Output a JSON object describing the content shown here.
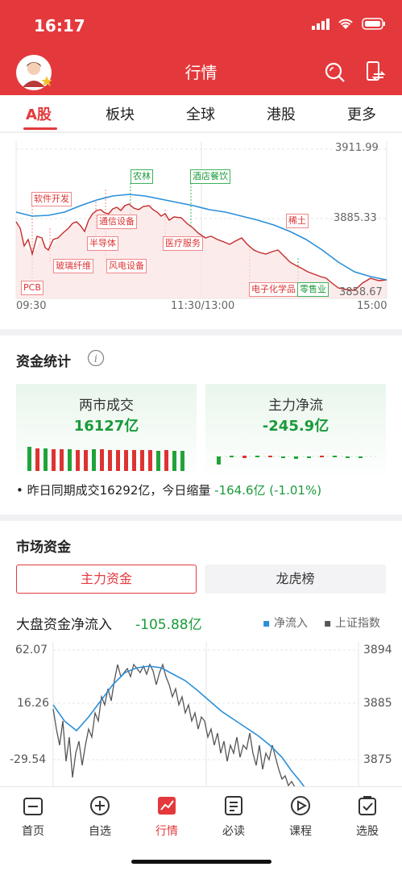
{
  "status": {
    "time": "16:17"
  },
  "header": {
    "title": "行情"
  },
  "tabs": [
    "A股",
    "板块",
    "全球",
    "港股",
    "更多"
  ],
  "colors": {
    "brand_red": "#e4393c",
    "up_red": "#d33",
    "down_green": "#1a9a3a",
    "line_blue": "#2a8fd8"
  },
  "index_chart": {
    "y_top": "3911.99",
    "y_mid": "3885.33",
    "y_bottom": "3858.67",
    "x_start": "09:30",
    "x_mid": "11:30/13:00",
    "x_end": "15:00",
    "tags_red": [
      "软件开发",
      "通信设备",
      "半导体",
      "玻璃纤维",
      "风电设备",
      "医疗服务",
      "稀土",
      "电子化学品",
      "PCB"
    ],
    "tags_green": [
      "农林",
      "酒店餐饮",
      "零售业"
    ]
  },
  "fund_stats": {
    "title": "资金统计",
    "info_icon": "info-icon",
    "turnover": {
      "title": "两市成交",
      "value": "16127亿"
    },
    "main_flow": {
      "title": "主力净流",
      "value": "-245.9亿"
    },
    "note_prefix": "昨日同期成交",
    "note_amount": "16292亿",
    "note_mid": "，今日缩量",
    "note_change": "-164.6亿 (-1.01%)"
  },
  "market_funds": {
    "title": "市场资金",
    "seg_main": "主力资金",
    "seg_lhb": "龙虎榜",
    "flow_title": "大盘资金净流入",
    "flow_value": "-105.88亿",
    "legend_net": "净流入",
    "legend_index": "上证指数",
    "left_ticks": [
      "62.07",
      "16.26",
      "-29.54"
    ],
    "right_ticks": [
      "3894",
      "3885",
      "3875"
    ]
  },
  "bottom_nav": [
    "首页",
    "自选",
    "行情",
    "必读",
    "课程",
    "选股"
  ]
}
